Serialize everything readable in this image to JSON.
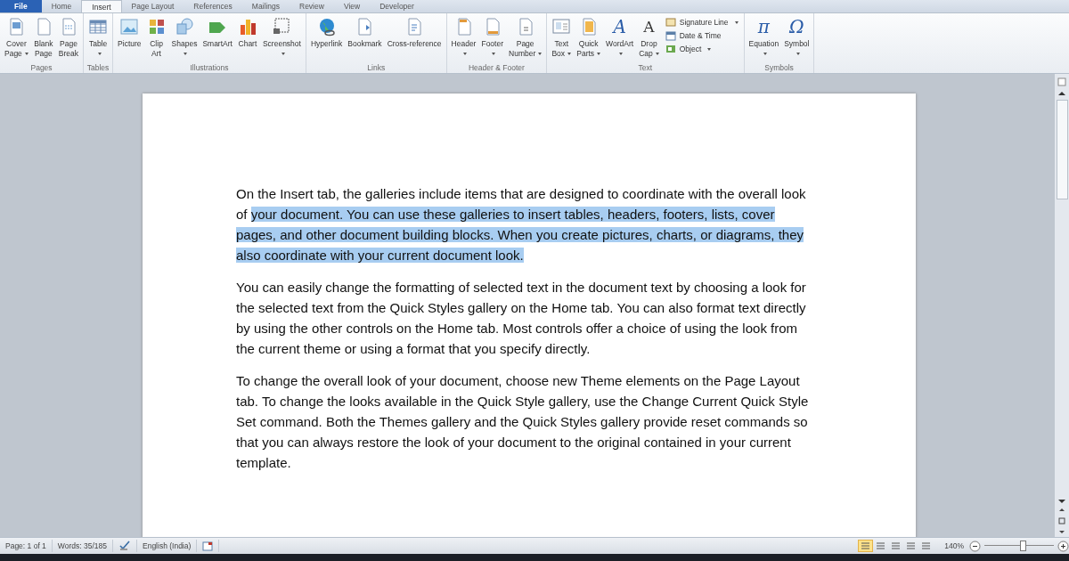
{
  "tabs": [
    {
      "label": "File",
      "kind": "file",
      "selected": false
    },
    {
      "label": "Home",
      "kind": "tab",
      "selected": false
    },
    {
      "label": "Insert",
      "kind": "tab",
      "selected": true
    },
    {
      "label": "Page Layout",
      "kind": "tab",
      "selected": false
    },
    {
      "label": "References",
      "kind": "tab",
      "selected": false
    },
    {
      "label": "Mailings",
      "kind": "tab",
      "selected": false
    },
    {
      "label": "Review",
      "kind": "tab",
      "selected": false
    },
    {
      "label": "View",
      "kind": "tab",
      "selected": false
    },
    {
      "label": "Developer",
      "kind": "tab",
      "selected": false
    }
  ],
  "ribbon": [
    {
      "label": "Pages",
      "buttons": [
        {
          "lines": [
            "Cover",
            "Page"
          ],
          "dropdown": true
        },
        {
          "lines": [
            "Blank",
            "Page"
          ],
          "dropdown": false
        },
        {
          "lines": [
            "Page",
            "Break"
          ],
          "dropdown": false
        }
      ]
    },
    {
      "label": "Tables",
      "buttons": [
        {
          "lines": [
            "Table"
          ],
          "dropdown": true
        }
      ]
    },
    {
      "label": "Illustrations",
      "buttons": [
        {
          "lines": [
            "Picture"
          ],
          "dropdown": false
        },
        {
          "lines": [
            "Clip",
            "Art"
          ],
          "dropdown": false
        },
        {
          "lines": [
            "Shapes"
          ],
          "dropdown": true
        },
        {
          "lines": [
            "SmartArt"
          ],
          "dropdown": false
        },
        {
          "lines": [
            "Chart"
          ],
          "dropdown": false
        },
        {
          "lines": [
            "Screenshot"
          ],
          "dropdown": true
        }
      ]
    },
    {
      "label": "Links",
      "buttons": [
        {
          "lines": [
            "Hyperlink"
          ],
          "dropdown": false
        },
        {
          "lines": [
            "Bookmark"
          ],
          "dropdown": false
        },
        {
          "lines": [
            "Cross-reference"
          ],
          "dropdown": false
        }
      ]
    },
    {
      "label": "Header & Footer",
      "buttons": [
        {
          "lines": [
            "Header"
          ],
          "dropdown": true
        },
        {
          "lines": [
            "Footer"
          ],
          "dropdown": true
        },
        {
          "lines": [
            "Page",
            "Number"
          ],
          "dropdown": true
        }
      ]
    },
    {
      "label": "Text",
      "buttons": [
        {
          "lines": [
            "Text",
            "Box"
          ],
          "dropdown": true
        },
        {
          "lines": [
            "Quick",
            "Parts"
          ],
          "dropdown": true
        },
        {
          "lines": [
            "WordArt"
          ],
          "dropdown": true,
          "glyph": "A"
        },
        {
          "lines": [
            "Drop",
            "Cap"
          ],
          "dropdown": true,
          "glyph": "A"
        }
      ],
      "small_buttons": [
        {
          "label": "Signature Line",
          "dropdown": true
        },
        {
          "label": "Date & Time",
          "dropdown": false
        },
        {
          "label": "Object",
          "dropdown": true
        }
      ]
    },
    {
      "label": "Symbols",
      "buttons": [
        {
          "lines": [
            "Equation"
          ],
          "dropdown": true,
          "glyph": "π"
        },
        {
          "lines": [
            "Symbol"
          ],
          "dropdown": true,
          "glyph": "Ω"
        }
      ]
    }
  ],
  "document": {
    "paragraphs": [
      [
        {
          "text": "On the Insert tab, the galleries include items that are designed to coordinate with the overall look of ",
          "selected": false
        },
        {
          "text": "your document. You can use these galleries to insert tables, headers, footers, lists, cover pages, and other document building blocks. When you create pictures, charts, or diagrams, they also coordinate with your current document look.",
          "selected": true
        }
      ],
      [
        {
          "text": "You can easily change the formatting of selected text in the document text by choosing a look for the selected text from the Quick Styles gallery on the Home tab. You can also format text directly by using the other controls on the Home tab. Most controls offer a choice of using the look from the current theme or using a format that you specify directly.",
          "selected": false
        }
      ],
      [
        {
          "text": "To change the overall look of your document, choose new Theme elements on the Page Layout tab. To change the looks available in the Quick Style gallery, use the Change Current Quick Style Set command. Both the Themes gallery and the Quick Styles gallery provide reset commands so that you can always restore the look of your document to the original contained in your current template.",
          "selected": false
        }
      ]
    ]
  },
  "status_bar": {
    "page": "Page: 1 of 1",
    "words": "Words: 35/185",
    "language": "English (India)",
    "views": [
      {
        "selected": true
      },
      {
        "selected": false
      },
      {
        "selected": false
      },
      {
        "selected": false
      },
      {
        "selected": false
      }
    ],
    "zoom": "140%",
    "zoom_slider": {
      "level": 0.55
    }
  }
}
